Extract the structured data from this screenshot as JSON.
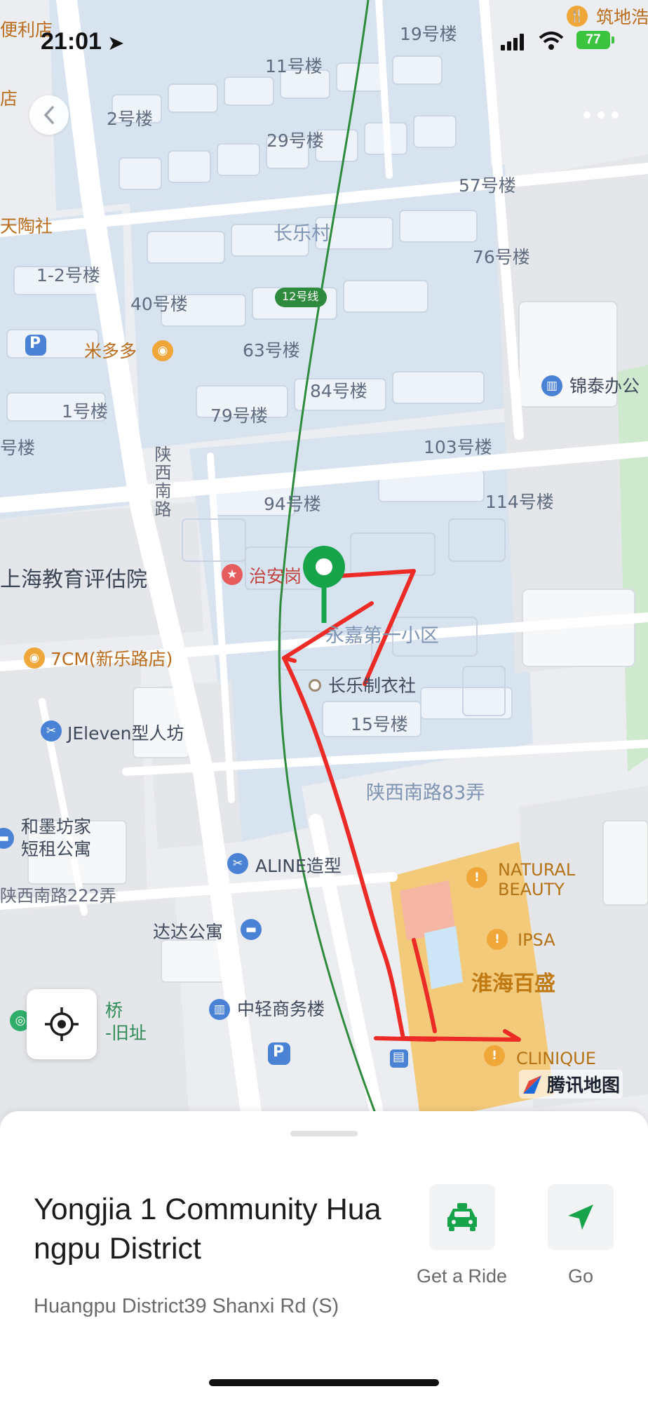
{
  "status_bar": {
    "time": "21:01",
    "battery": "77"
  },
  "map": {
    "labels": {
      "b19": "19号楼",
      "b11": "11号楼",
      "b2": "2号楼",
      "b29": "29号楼",
      "b57": "57号楼",
      "changle_village": "长乐村",
      "b76": "76号楼",
      "b1_2": "1-2号楼",
      "b40": "40号楼",
      "b63": "63号楼",
      "b84": "84号楼",
      "b79": "79号楼",
      "b1": "1号楼",
      "b103": "103号楼",
      "b94": "94号楼",
      "b114": "114号楼",
      "b15": "15号楼",
      "b_partial": "号楼",
      "shaanxi_s_road": "陕西南路",
      "lane83": "陕西南路83弄",
      "lane222": "陕西南路222弄",
      "yongjia": "永嘉第一小区",
      "edu_institute": "上海教育评估院",
      "tianyao": "天陶社",
      "convenience": "便利店",
      "store_partial": "店",
      "zhudi": "筑地浩",
      "jintai": "锦泰办公",
      "mi_duo_duo": "米多多",
      "zhian": "治安岗",
      "cm7": "7CM(新乐路店)",
      "changle_tailor": "长乐制衣社",
      "jeleven": "JEleven型人坊",
      "hemo_1": "和墨坊家",
      "hemo_2": "短租公寓",
      "aline": "ALINE造型",
      "dada": "达达公寓",
      "zhongqing": "中轻商务楼",
      "qiao_1": "桥",
      "qiao_2": "-旧址",
      "natural_1": "NATURAL",
      "natural_2": "BEAUTY",
      "ipsa": "IPSA",
      "huaihai_mall": "淮海百盛",
      "clinique": "CLINIQUE",
      "metro_line": "12号线",
      "map_brand": "腾讯地图"
    }
  },
  "place": {
    "title": "Yongjia 1 Community Huangpu District",
    "address": "Huangpu District39 Shanxi Rd (S)"
  },
  "actions": {
    "ride_label": "Get a Ride",
    "go_label": "Go"
  },
  "colors": {
    "accent": "#17a34a",
    "route_drawn": "#ec2a26",
    "metro": "#2e8b3d"
  },
  "icons": {
    "back": "chevron-left-icon",
    "more": "more-dots-icon",
    "locate": "crosshair-icon",
    "ride": "taxi-icon",
    "go": "navigate-arrow-icon"
  }
}
